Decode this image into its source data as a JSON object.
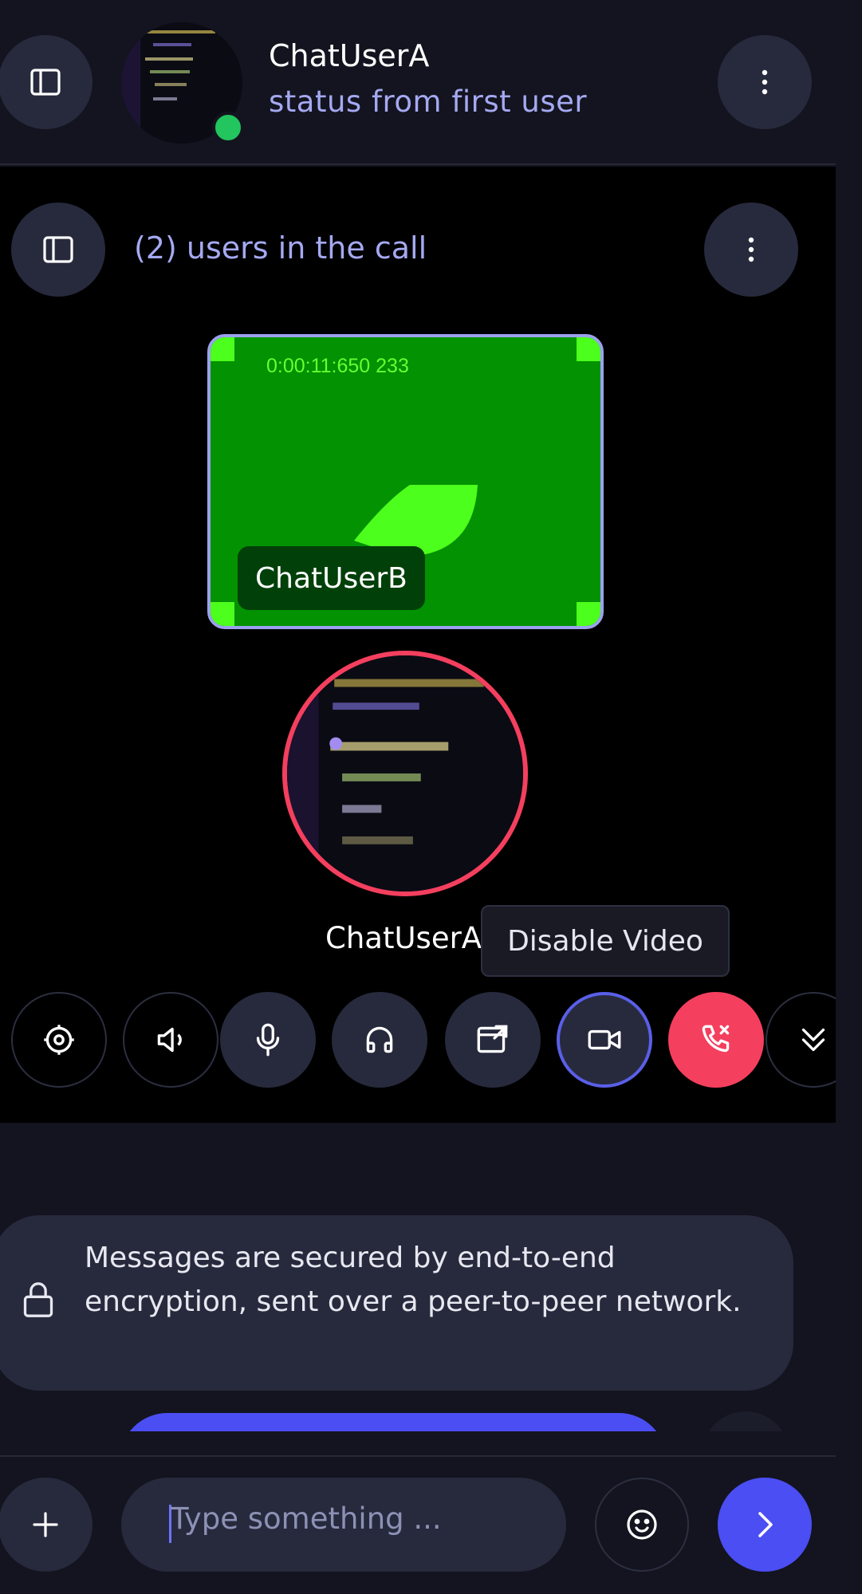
{
  "header": {
    "user_name": "ChatUserA",
    "user_status": "status from first user",
    "online": true
  },
  "call": {
    "users_count_label": "(2) users in the call",
    "remote_user": "ChatUserB",
    "timecode": "0:00:11:650 233",
    "local_user": "ChatUserA",
    "tooltip": "Disable Video",
    "controls": [
      "settings",
      "speaker",
      "microphone",
      "headphones",
      "screen-share",
      "video",
      "hang-up",
      "collapse"
    ]
  },
  "notice": {
    "text": "Messages are secured by end-to-end encryption, sent over a peer-to-peer network."
  },
  "composer": {
    "placeholder": "Type something ..."
  },
  "colors": {
    "accent": "#4b4ef2",
    "danger": "#f43f5e",
    "online": "#22c55e",
    "video_bg": "#029202",
    "muted_text": "#a5a9f2"
  }
}
